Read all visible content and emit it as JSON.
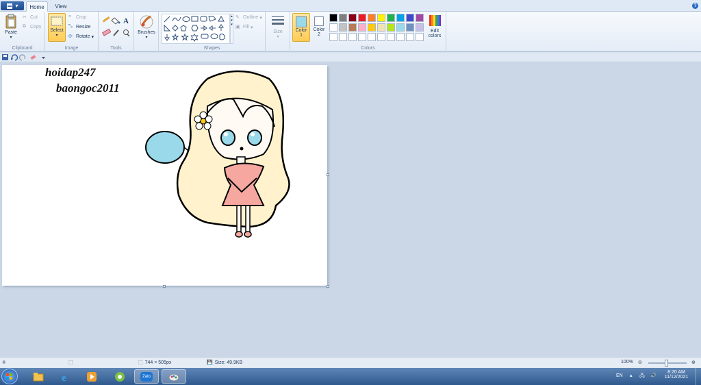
{
  "tabs": {
    "home": "Home",
    "view": "View"
  },
  "clipboard": {
    "paste": "Paste",
    "cut": "Cut",
    "copy": "Copy",
    "label": "Clipboard"
  },
  "image": {
    "select": "Select",
    "crop": "Crop",
    "resize": "Resize",
    "rotate": "Rotate",
    "label": "Image"
  },
  "tools": {
    "label": "Tools"
  },
  "brushes": {
    "label": "Brushes"
  },
  "shapes": {
    "outline": "Outline",
    "fill": "Fill",
    "label": "Shapes"
  },
  "size": {
    "label": "Size"
  },
  "colors": {
    "color1_label": "Color",
    "color1_num": "1",
    "color2_label": "Color",
    "color2_num": "2",
    "edit_label": "Edit",
    "edit_label2": "colors",
    "label": "Colors",
    "color1": "#99d9ea",
    "color2": "#ffffff",
    "palette_row1": [
      "#000000",
      "#7f7f7f",
      "#880015",
      "#ed1c24",
      "#ff7f27",
      "#fff200",
      "#22b14c",
      "#00a2e8",
      "#3f48cc",
      "#a349a4"
    ],
    "palette_row2": [
      "#ffffff",
      "#c3c3c3",
      "#b97a57",
      "#ffaec9",
      "#ffc90e",
      "#efe4b0",
      "#b5e61d",
      "#99d9ea",
      "#7092be",
      "#c8bfe7"
    ]
  },
  "canvas": {
    "text_line1": "hoidap247",
    "text_line2": "baongoc2011"
  },
  "status": {
    "dimensions": "744 × 505px",
    "size": "Size: 49.9KB",
    "zoom": "100%"
  },
  "tray": {
    "lang": "EN",
    "time": "8:20 AM",
    "date": "11/12/2021"
  },
  "taskbar": {
    "zalo": "Zalo"
  }
}
